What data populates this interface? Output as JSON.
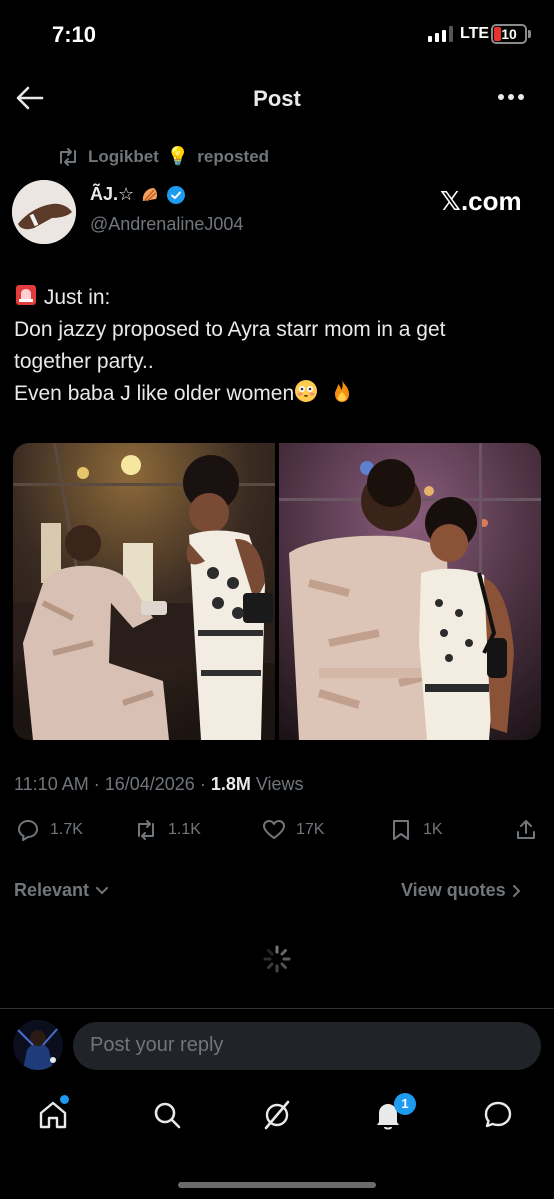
{
  "status_bar": {
    "time": "7:10",
    "network": "LTE",
    "battery": "10"
  },
  "header": {
    "title": "Post",
    "back_icon": "arrow-left-icon",
    "more_icon": "more-horizontal-icon"
  },
  "repost": {
    "user": "Logikbet",
    "suffix": "reposted"
  },
  "author": {
    "name": "ÃJ.☆",
    "handle": "@AndrenalineJ004",
    "verified": true
  },
  "source_label": "𝕏.com",
  "tweet": {
    "lines": [
      "Just in:",
      "Don jazzy proposed to Ayra starr mom in a get",
      "together  party..",
      "Even baba J like older women"
    ]
  },
  "meta": {
    "time": "11:10 AM",
    "date": "16/04/2026",
    "views_count": "1.8M",
    "views_label": "Views"
  },
  "actions": {
    "replies": "1.7K",
    "reposts": "1.1K",
    "likes": "17K",
    "bookmarks": "1K"
  },
  "sort": {
    "relevant_label": "Relevant",
    "view_quotes_label": "View quotes"
  },
  "reply_bar": {
    "placeholder": "Post your reply"
  },
  "nav": {
    "notification_badge": "1"
  },
  "colors": {
    "background": "#000000",
    "accent": "#1d9bf0",
    "muted": "#71767b",
    "text": "#e7e9ea",
    "battery_low": "#e5342b"
  }
}
